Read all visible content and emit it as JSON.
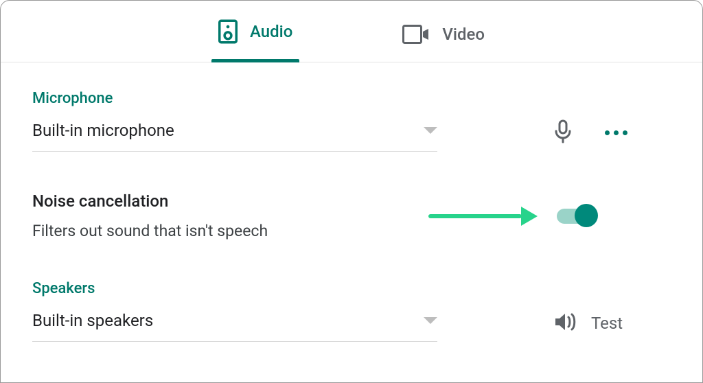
{
  "tabs": {
    "audio": "Audio",
    "video": "Video"
  },
  "microphone": {
    "label": "Microphone",
    "value": "Built-in microphone"
  },
  "noise_cancellation": {
    "title": "Noise cancellation",
    "description": "Filters out sound that isn't speech",
    "enabled": true
  },
  "speakers": {
    "label": "Speakers",
    "value": "Built-in speakers",
    "test_label": "Test"
  },
  "colors": {
    "accent": "#00796b",
    "annotation_arrow": "#27d38b"
  }
}
